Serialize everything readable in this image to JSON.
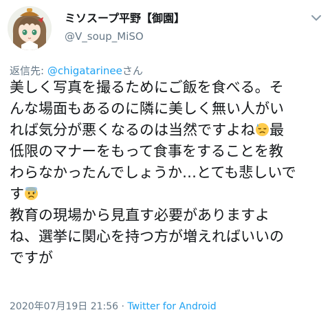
{
  "user": {
    "display_name": "ミソスープ平野【御園】",
    "handle": "@V_soup_MiSO"
  },
  "reply": {
    "prefix": "返信先: ",
    "mention": "@chigatarinee",
    "suffix": "さん"
  },
  "tweet": {
    "lines": [
      {
        "text": "美しく写真を撮るためにご飯を食べる。そ"
      },
      {
        "text": "んな場面もあるのに隣に美しく無い人がい"
      },
      {
        "text": "れば気分が悪くなるのは当然ですよね",
        "emoji": "downcast-sweat-face-icon",
        "after": "最"
      },
      {
        "text": "低限のマナーをもって食事をすることを教"
      },
      {
        "text": "わらなかったんでしょうか…とても悲しいで"
      },
      {
        "text": "す",
        "emoji": "anxious-sweat-face-icon",
        "after": ""
      },
      {
        "text": "教育の現場から見直す必要がありますよ"
      },
      {
        "text": "ね、選挙に関心を持つ方が増えればいいの"
      },
      {
        "text": "ですが"
      }
    ]
  },
  "footer": {
    "timestamp": "2020年07月19日 21:56",
    "separator": " · ",
    "source": "Twitter for Android"
  },
  "colors": {
    "text": "#14171a",
    "secondary": "#657786",
    "link": "#1da1f2",
    "emoji": "#ffcc4d"
  },
  "icons": [
    "avatar",
    "chevron-down-icon",
    "downcast-sweat-face-icon",
    "anxious-sweat-face-icon"
  ]
}
